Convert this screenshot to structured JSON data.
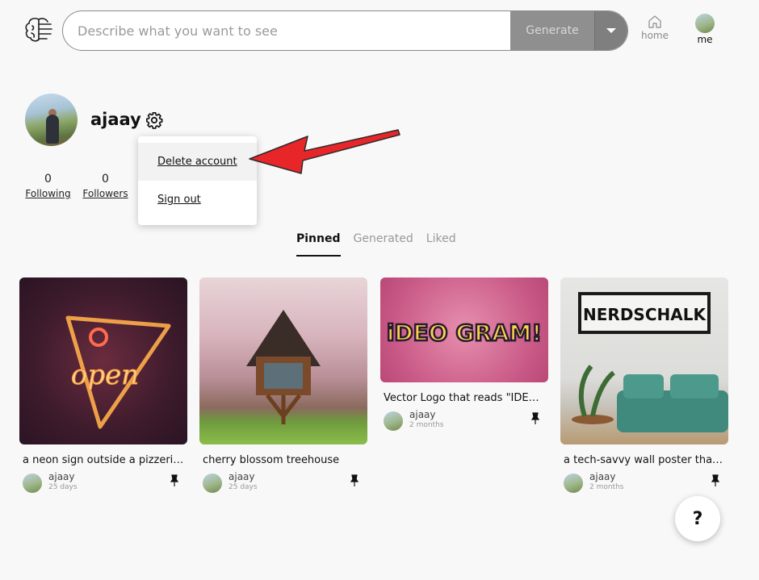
{
  "header": {
    "logo_icon": "brain-icon",
    "prompt_placeholder": "Describe what you want to see",
    "generate_label": "Generate",
    "nav": [
      {
        "label": "home",
        "icon": "home-icon"
      },
      {
        "label": "me",
        "icon": "avatar"
      }
    ]
  },
  "profile": {
    "username": "ajaay",
    "following_count": "0",
    "following_label": "Following",
    "followers_count": "0",
    "followers_label": "Followers"
  },
  "menu": {
    "items": [
      {
        "label": "Delete account"
      },
      {
        "label": "Sign out"
      }
    ]
  },
  "tabs": [
    {
      "label": "Pinned"
    },
    {
      "label": "Generated"
    },
    {
      "label": "Liked"
    }
  ],
  "cards": [
    {
      "title": "a neon sign outside a pizzeria...",
      "author": "ajaay",
      "age": "25 days",
      "image_text": "open"
    },
    {
      "title": "cherry blossom treehouse",
      "author": "ajaay",
      "age": "25 days"
    },
    {
      "title": "Vector Logo that reads \"IDEO...",
      "author": "ajaay",
      "age": "2 months",
      "image_text": "iDEO GRAM!"
    },
    {
      "title": "a tech-savvy wall poster that...",
      "author": "ajaay",
      "age": "2 months",
      "image_text": "NERDSCHALK"
    }
  ],
  "help": {
    "label": "?"
  },
  "colors": {
    "accent_arrow": "#e8262a",
    "generate_bg": "#8f8f8f"
  }
}
